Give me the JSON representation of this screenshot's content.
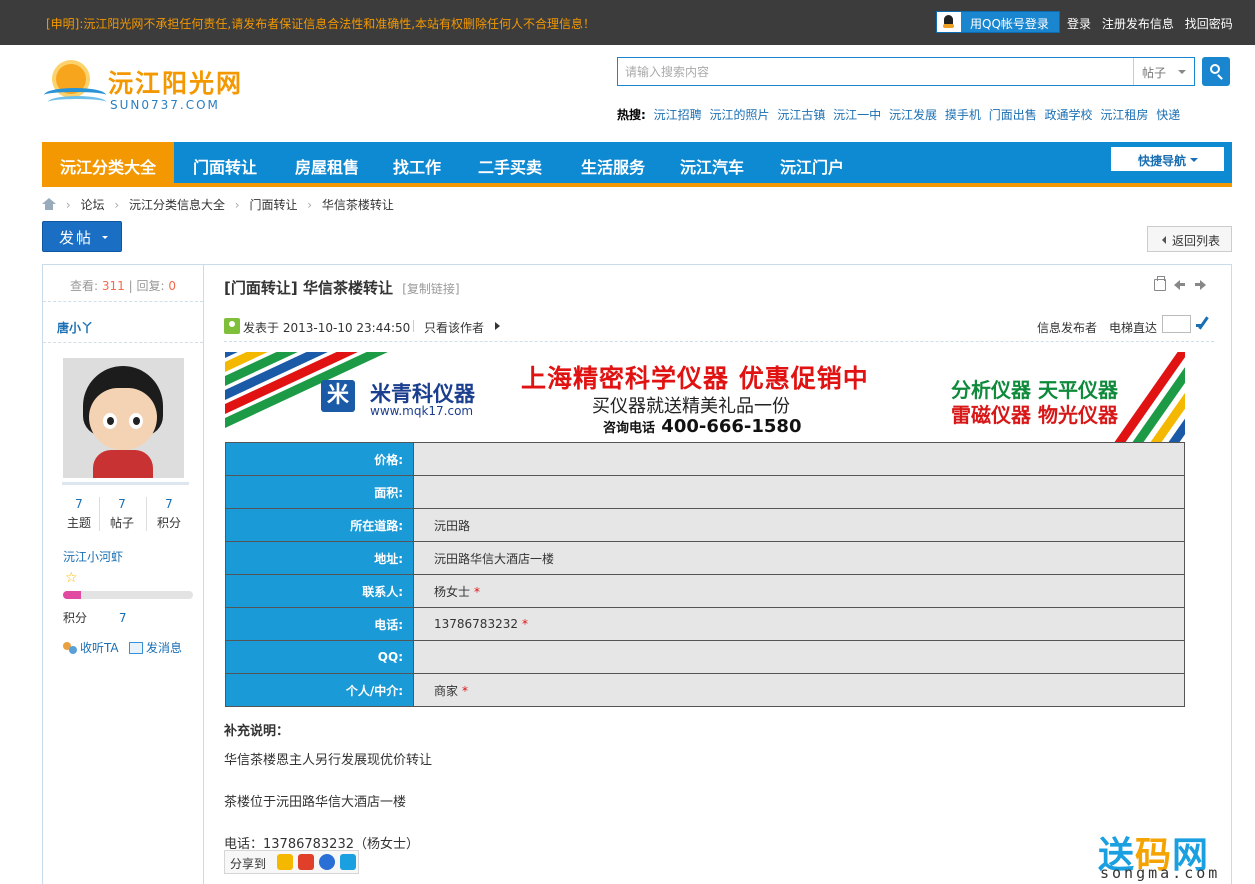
{
  "topbar": {
    "notice": "[申明]:沅江阳光网不承担任何责任,请发布者保证信息合法性和准确性,本站有权删除任何人不合理信息！",
    "qq_login": "用QQ帐号登录",
    "login": "登录",
    "register": "注册发布信息",
    "recover": "找回密码"
  },
  "logo": {
    "name": "沅江阳光网",
    "domain": "SUN0737.COM"
  },
  "search": {
    "placeholder": "请输入搜索内容",
    "scope": "帖子",
    "hot_label": "热搜:",
    "hot": [
      "沅江招聘",
      "沅江的照片",
      "沅江古镇",
      "沅江一中",
      "沅江发展",
      "摸手机",
      "门面出售",
      "政通学校",
      "沅江租房",
      "快递"
    ]
  },
  "nav": {
    "items": [
      "沅江分类大全",
      "门面转让",
      "房屋租售",
      "找工作",
      "二手买卖",
      "生活服务",
      "沅江汽车",
      "沅江门户"
    ],
    "quick": "快捷导航"
  },
  "breadcrumb": [
    "论坛",
    "沅江分类信息大全",
    "门面转让",
    "华信茶楼转让"
  ],
  "buttons": {
    "post": "发帖",
    "back": "返回列表"
  },
  "sidebar": {
    "views_label": "查看:",
    "views": "311",
    "replies_label": "回复:",
    "replies": "0",
    "username": "唐小丫",
    "stats": [
      {
        "value": "7",
        "label": "主题"
      },
      {
        "value": "7",
        "label": "帖子"
      },
      {
        "value": "7",
        "label": "积分"
      }
    ],
    "group": "沅江小河虾",
    "level_fraction": 0.14,
    "credit_label": "积分",
    "credit": "7",
    "follow": "收听TA",
    "message": "发消息"
  },
  "post": {
    "category": "[门面转让]",
    "title": "华信茶楼转让",
    "copy_link": "[复制链接]",
    "posted_label": "发表于",
    "posted_at": "2013-10-10 23:44:50",
    "only_author": "只看该作者",
    "role": "信息发布者",
    "jump": "电梯直达"
  },
  "ad": {
    "logo_char": "米",
    "brand": "米青科仪器",
    "url": "www.mqk17.com",
    "headline": "上海精密科学仪器  优惠促销中",
    "sub": "买仪器就送精美礼品一份",
    "phone_label": "咨询电话",
    "phone": "400-666-1580",
    "right1": "分析仪器 天平仪器",
    "right2": "雷磁仪器 物光仪器"
  },
  "info_rows": [
    {
      "label": "价格:",
      "value": "",
      "required": ""
    },
    {
      "label": "面积:",
      "value": "",
      "required": ""
    },
    {
      "label": "所在道路:",
      "value": "沅田路",
      "required": ""
    },
    {
      "label": "地址:",
      "value": "沅田路华信大酒店一楼",
      "required": ""
    },
    {
      "label": "联系人:",
      "value": "杨女士",
      "required": "*"
    },
    {
      "label": "电话:",
      "value": "13786783232",
      "required": "*"
    },
    {
      "label": "QQ:",
      "value": "",
      "required": ""
    },
    {
      "label": "个人/中介:",
      "value": "商家",
      "required": "*"
    }
  ],
  "notes": {
    "heading": "补充说明：",
    "lines": [
      "华信茶楼恩主人另行发展现优价转让",
      "茶楼位于沅田路华信大酒店一楼",
      "电话：13786783232（杨女士）"
    ]
  },
  "share": {
    "label": "分享到"
  },
  "watermark": {
    "big_a": "送",
    "big_b": "码",
    "big_c": "网",
    "small": "songma.com"
  },
  "colors": {
    "brand_blue": "#0e8ad3",
    "accent_orange": "#f39800",
    "table_label": "#1a9ad6"
  }
}
